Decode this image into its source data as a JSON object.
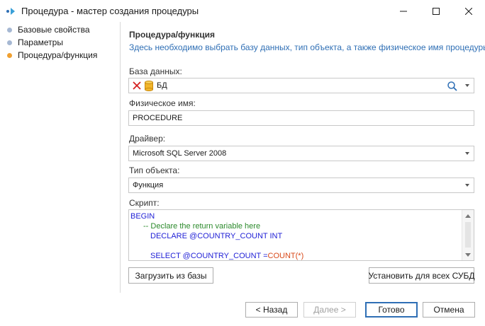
{
  "window": {
    "title": "Процедура - мастер создания процедуры"
  },
  "steps": [
    {
      "label": "Базовые свойства",
      "state": "done"
    },
    {
      "label": "Параметры",
      "state": "done"
    },
    {
      "label": "Процедура/функция",
      "state": "active"
    }
  ],
  "main": {
    "heading": "Процедура/функция",
    "description": "Здесь необходимо выбрать базу данных, тип объекта, а также физическое имя процедуры.",
    "database": {
      "label": "База данных:",
      "value": "БД"
    },
    "physical_name": {
      "label": "Физическое имя:",
      "value": "PROCEDURE"
    },
    "driver": {
      "label": "Драйвер:",
      "value": "Microsoft SQL Server 2008"
    },
    "object_type": {
      "label": "Тип объекта:",
      "value": "Функция"
    },
    "script": {
      "label": "Скрипт:",
      "lines": {
        "l1": "BEGIN",
        "l2": "-- Declare the return variable here",
        "l3_kw": "DECLARE",
        "l3_rest": " @COUNTRY_COUNT INT",
        "l5_kw": "SELECT",
        "l5_var": " @COUNTRY_COUNT =",
        "l5_fn": "COUNT",
        "l5_end": "(*)"
      }
    },
    "load_button": "Загрузить из базы",
    "set_all_button": "Установить для всех СУБД"
  },
  "footer": {
    "back": "< Назад",
    "next": "Далее >",
    "done": "Готово",
    "cancel": "Отмена"
  },
  "colors": {
    "accent": "#2f6fb5",
    "active_step": "#f0a030",
    "done_step": "#a6b8d3"
  }
}
